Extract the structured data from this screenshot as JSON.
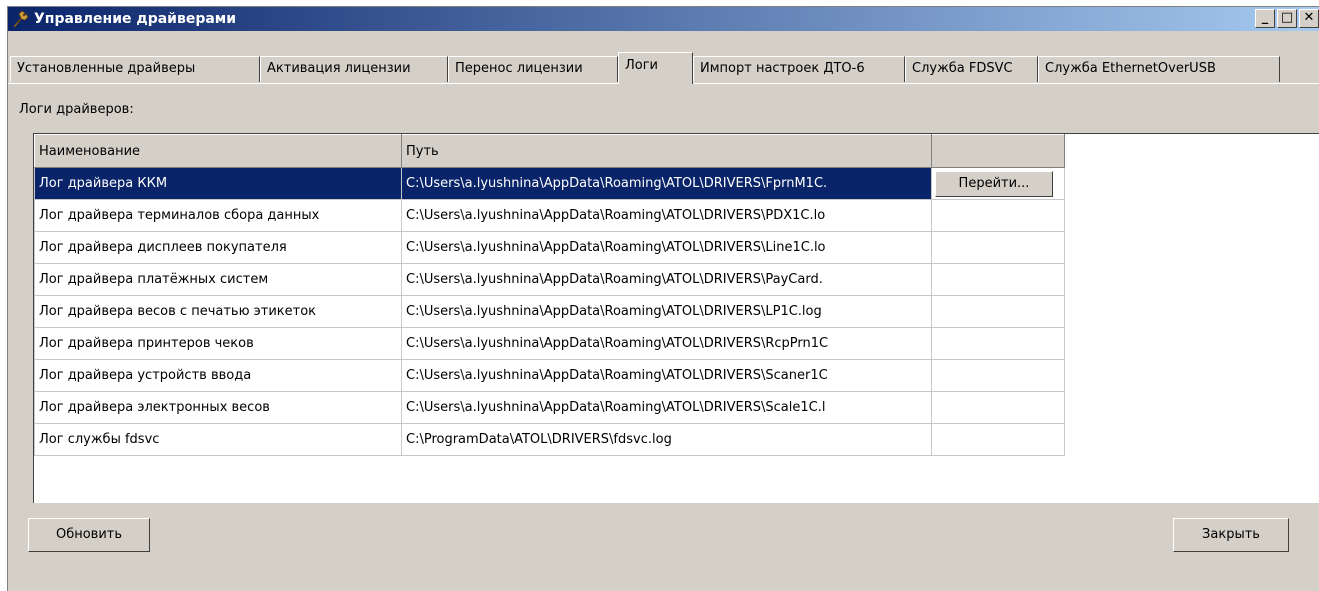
{
  "window": {
    "title": "Управление драйверами",
    "controls": {
      "minimize": "_",
      "maximize": "□",
      "close": "✕"
    }
  },
  "tabs": [
    {
      "label": "Установленные драйверы"
    },
    {
      "label": "Активация лицензии"
    },
    {
      "label": "Перенос лицензии"
    },
    {
      "label": "Логи"
    },
    {
      "label": "Импорт настроек ДТО-6"
    },
    {
      "label": "Служба FDSVC"
    },
    {
      "label": "Служба EthernetOverUSB"
    }
  ],
  "active_tab": "Логи",
  "logs": {
    "section_label": "Логи драйверов:",
    "columns": [
      "Наименование",
      "Путь",
      ""
    ],
    "rows": [
      {
        "name": "Лог драйвера ККМ",
        "path": "C:\\Users\\a.lyushnina\\AppData\\Roaming\\ATOL\\DRIVERS\\FprnM1C.",
        "action": "Перейти..."
      },
      {
        "name": "Лог драйвера терминалов сбора данных",
        "path": "C:\\Users\\a.lyushnina\\AppData\\Roaming\\ATOL\\DRIVERS\\PDX1C.lo",
        "action": ""
      },
      {
        "name": "Лог драйвера дисплеев покупателя",
        "path": "C:\\Users\\a.lyushnina\\AppData\\Roaming\\ATOL\\DRIVERS\\Line1C.lo",
        "action": ""
      },
      {
        "name": "Лог драйвера платёжных систем",
        "path": "C:\\Users\\a.lyushnina\\AppData\\Roaming\\ATOL\\DRIVERS\\PayCard.",
        "action": ""
      },
      {
        "name": "Лог драйвера весов с печатью этикеток",
        "path": "C:\\Users\\a.lyushnina\\AppData\\Roaming\\ATOL\\DRIVERS\\LP1C.log",
        "action": ""
      },
      {
        "name": "Лог драйвера принтеров чеков",
        "path": "C:\\Users\\a.lyushnina\\AppData\\Roaming\\ATOL\\DRIVERS\\RcpPrn1C",
        "action": ""
      },
      {
        "name": "Лог драйвера устройств ввода",
        "path": "C:\\Users\\a.lyushnina\\AppData\\Roaming\\ATOL\\DRIVERS\\Scaner1C",
        "action": ""
      },
      {
        "name": "Лог драйвера электронных весов",
        "path": "C:\\Users\\a.lyushnina\\AppData\\Roaming\\ATOL\\DRIVERS\\Scale1C.l",
        "action": ""
      },
      {
        "name": "Лог службы fdsvc",
        "path": "C:\\ProgramData\\ATOL\\DRIVERS\\fdsvc.log",
        "action": ""
      }
    ]
  },
  "buttons": {
    "refresh": "Обновить",
    "close": "Закрыть"
  },
  "colors": {
    "titlebar_start": "#0a246a",
    "titlebar_end": "#a6caf0",
    "selection": "#0a246a",
    "face": "#d4d0c8"
  },
  "icons": {
    "title_icon": "wrench-icon"
  }
}
